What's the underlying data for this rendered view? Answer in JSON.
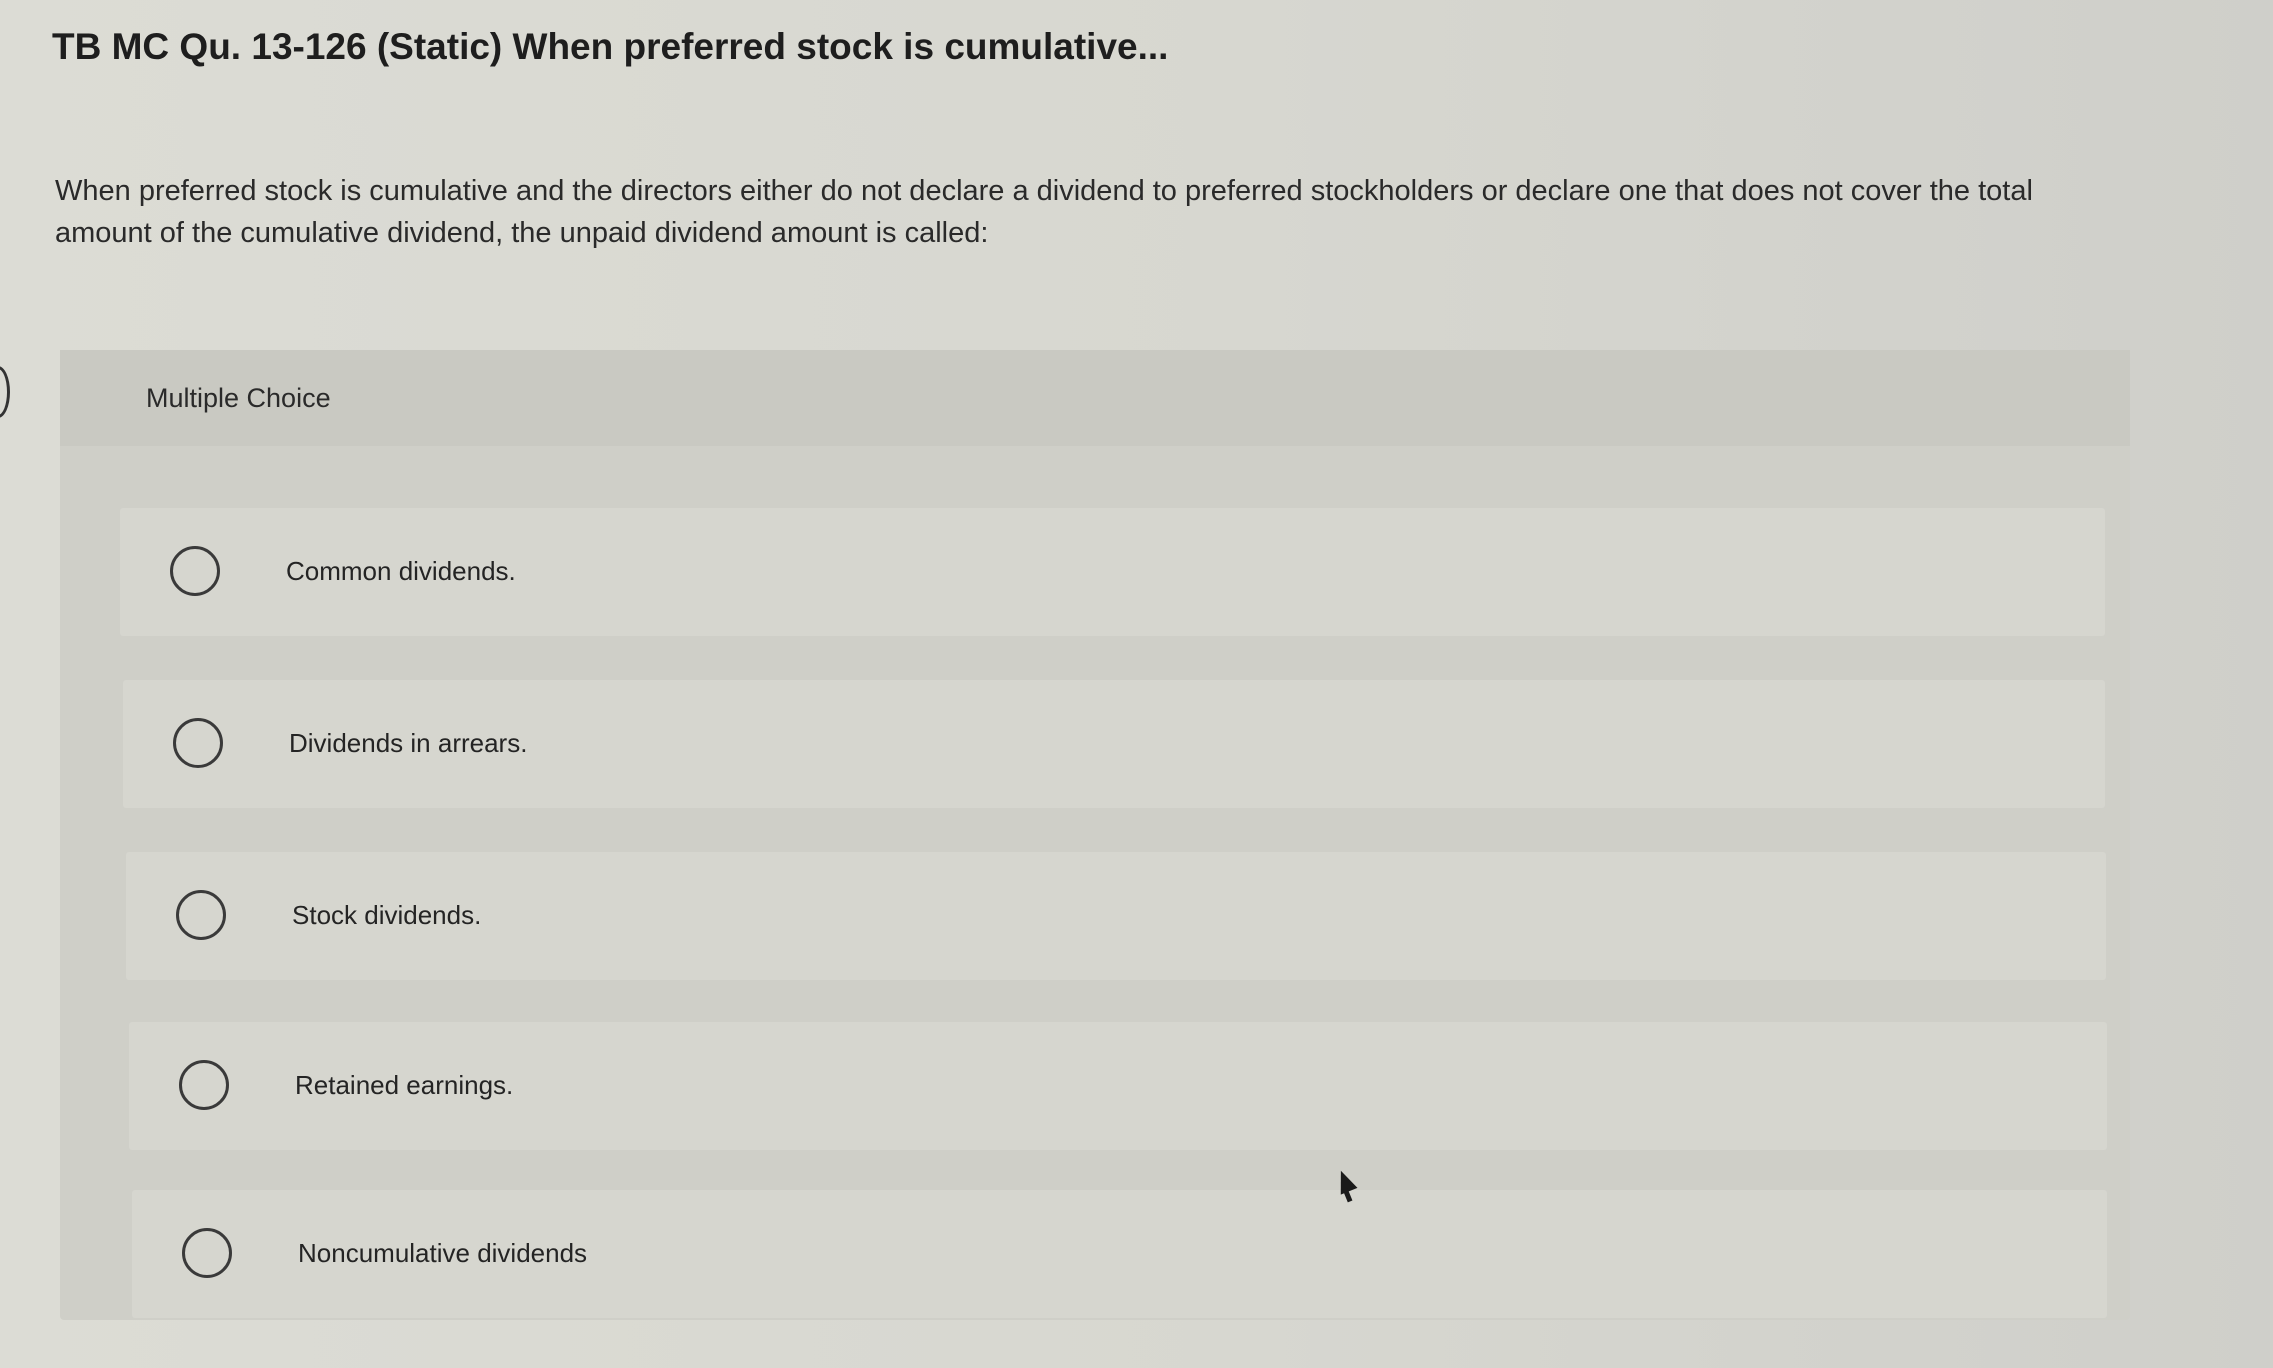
{
  "page": {
    "title": "TB MC Qu. 13-126 (Static) When preferred stock is cumulative...",
    "question": "When preferred stock is cumulative and the directors either do not declare a dividend to preferred stockholders or declare one that does not cover the total amount of the cumulative dividend, the unpaid dividend amount is called:"
  },
  "multiple_choice": {
    "label": "Multiple Choice",
    "options": [
      {
        "label": "Common dividends."
      },
      {
        "label": "Dividends in arrears."
      },
      {
        "label": "Stock dividends."
      },
      {
        "label": "Retained earnings."
      },
      {
        "label": "Noncumulative dividends"
      }
    ]
  },
  "colors": {
    "background": "#d9d9d2",
    "panel": "#cfcfc8",
    "option_row": "#d6d6cf",
    "text": "#222222"
  },
  "icons": {
    "radio": "radio-button-unselected-icon",
    "cursor": "mouse-pointer-icon"
  }
}
